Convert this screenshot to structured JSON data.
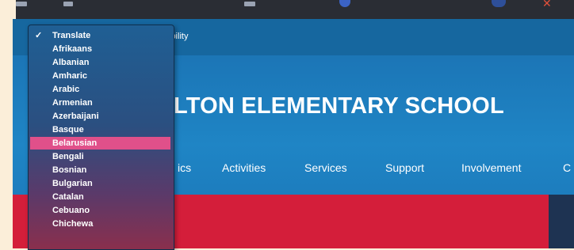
{
  "utility_bar": {
    "accessibility_label": "ssibility"
  },
  "school": {
    "title": "LTON ELEMENTARY SCHOOL"
  },
  "nav": {
    "items": [
      "ics",
      "Activities",
      "Services",
      "Support",
      "Involvement",
      "C"
    ]
  },
  "language_dropdown": {
    "checked_option": "Translate",
    "highlighted_option": "Belarusian",
    "options": [
      "Translate",
      "Afrikaans",
      "Albanian",
      "Amharic",
      "Arabic",
      "Armenian",
      "Azerbaijani",
      "Basque",
      "Belarusian",
      "Bengali",
      "Bosnian",
      "Bulgarian",
      "Catalan",
      "Cebuano",
      "Chichewa"
    ]
  },
  "colors": {
    "header_blue": "#1f85c5",
    "hero_red": "#d41e3a",
    "highlight_pink": "#e0508a"
  }
}
